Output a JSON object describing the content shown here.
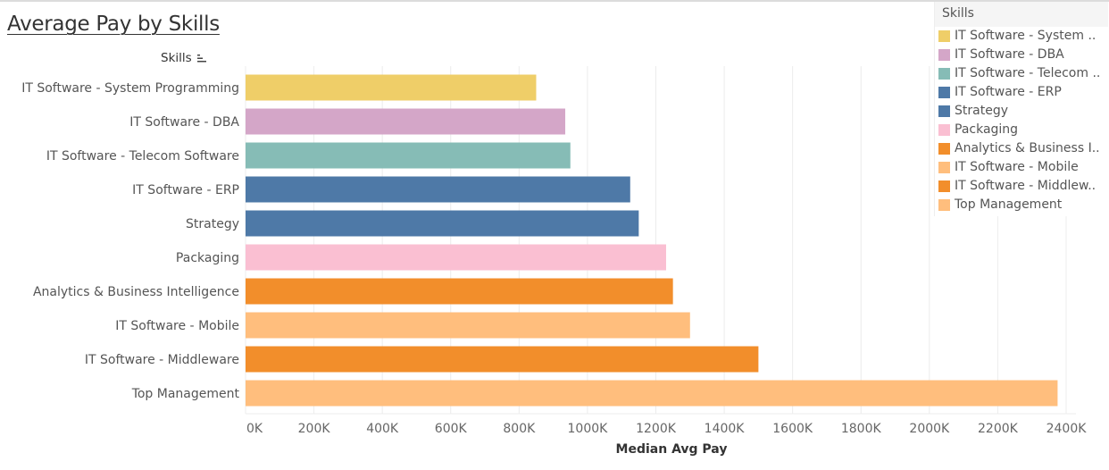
{
  "title": "Average Pay by Skills",
  "row_header": "Skills",
  "legend": {
    "title": "Skills",
    "items": [
      {
        "label": "IT Software - System ..",
        "color": "#EFCE68"
      },
      {
        "label": "IT Software - DBA",
        "color": "#D4A6C8"
      },
      {
        "label": "IT Software - Telecom ..",
        "color": "#86BCB6"
      },
      {
        "label": "IT Software - ERP",
        "color": "#4E79A7"
      },
      {
        "label": "Strategy",
        "color": "#4E79A7"
      },
      {
        "label": "Packaging",
        "color": "#FABFD2"
      },
      {
        "label": "Analytics & Business I..",
        "color": "#F28E2B"
      },
      {
        "label": "IT Software - Mobile",
        "color": "#FFBE7D"
      },
      {
        "label": "IT Software - Middlew..",
        "color": "#F28E2B"
      },
      {
        "label": "Top Management",
        "color": "#FFBE7D"
      }
    ]
  },
  "chart_data": {
    "type": "bar",
    "orientation": "horizontal",
    "title": "Average Pay by Skills",
    "xlabel": "Median Avg Pay",
    "ylabel": "Skills",
    "categories": [
      "IT Software - System Programming",
      "IT Software - DBA",
      "IT Software - Telecom Software",
      "IT Software - ERP",
      "Strategy",
      "Packaging",
      "Analytics & Business Intelligence",
      "IT Software - Mobile",
      "IT Software - Middleware",
      "Top Management"
    ],
    "values": [
      850000,
      935000,
      950000,
      1125000,
      1150000,
      1230000,
      1250000,
      1300000,
      1500000,
      2375000
    ],
    "colors": [
      "#EFCE68",
      "#D4A6C8",
      "#86BCB6",
      "#4E79A7",
      "#4E79A7",
      "#FABFD2",
      "#F28E2B",
      "#FFBE7D",
      "#F28E2B",
      "#FFBE7D"
    ],
    "xlim": [
      0,
      2400000
    ],
    "xticks": [
      0,
      200000,
      400000,
      600000,
      800000,
      1000000,
      1200000,
      1400000,
      1600000,
      1800000,
      2000000,
      2200000,
      2400000
    ],
    "xtick_labels": [
      "0K",
      "200K",
      "400K",
      "600K",
      "800K",
      "1000K",
      "1200K",
      "1400K",
      "1600K",
      "1800K",
      "2000K",
      "2200K",
      "2400K"
    ],
    "grid": true,
    "legend_position": "top-right",
    "sorted": "ascending"
  }
}
